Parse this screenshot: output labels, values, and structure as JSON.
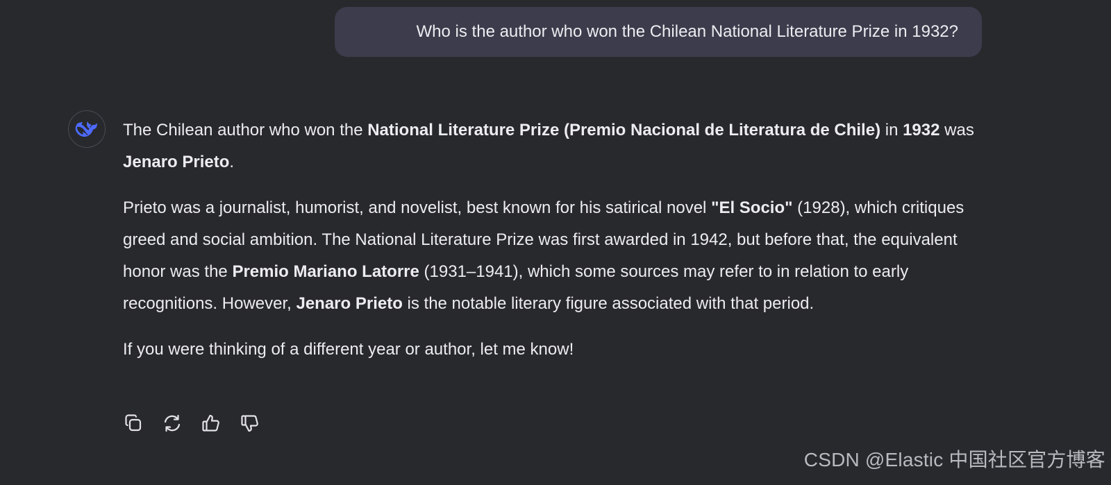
{
  "user_message": {
    "text": "Who is the author who won the Chilean National Literature Prize in 1932?"
  },
  "assistant": {
    "avatar_icon": "deepseek-whale-icon",
    "p1": {
      "t1": "The Chilean author who won the ",
      "b1": "National Literature Prize (Premio Nacional de Literatura de Chile)",
      "t2": " in ",
      "b2": "1932",
      "t3": " was ",
      "b3": "Jenaro Prieto",
      "t4": "."
    },
    "p2": {
      "t1": "Prieto was a journalist, humorist, and novelist, best known for his satirical novel ",
      "b1": "\"El Socio\"",
      "t2": " (1928), which critiques greed and social ambition. The National Literature Prize was first awarded in 1942, but before that, the equivalent honor was the ",
      "b2": "Premio Mariano Latorre",
      "t3": " (1931–1941), which some sources may refer to in relation to early recognitions. However, ",
      "b3": "Jenaro Prieto",
      "t4": " is the notable literary figure associated with that period."
    },
    "p3": {
      "text": "If you were thinking of a different year or author, let me know!"
    }
  },
  "actions": [
    {
      "icon": "copy-icon"
    },
    {
      "icon": "regenerate-icon"
    },
    {
      "icon": "thumbs-up-icon"
    },
    {
      "icon": "thumbs-down-icon"
    }
  ],
  "watermark": "CSDN @Elastic 中国社区官方博客",
  "colors": {
    "background": "#28292d",
    "user_bubble": "#3c3c4c",
    "text": "#ececf1",
    "accent": "#4d6bfe"
  }
}
